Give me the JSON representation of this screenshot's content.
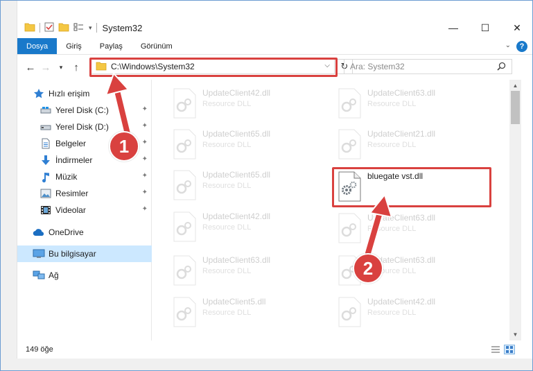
{
  "window": {
    "title": "System32",
    "controls": {
      "minimize": "—",
      "maximize": "☐",
      "close": "✕"
    }
  },
  "ribbon": {
    "tabs": [
      "Dosya",
      "Giriş",
      "Paylaş",
      "Görünüm"
    ],
    "active_tab": "Dosya",
    "help": "?"
  },
  "address_bar": {
    "path": "C:\\Windows\\System32",
    "search_placeholder": "Ara: System32"
  },
  "sidebar": {
    "quick_access": "Hızlı erişim",
    "pinned": [
      {
        "label": "Yerel Disk (C:)",
        "icon": "drive-icon"
      },
      {
        "label": "Yerel Disk (D:)",
        "icon": "drive-icon"
      },
      {
        "label": "Belgeler",
        "icon": "documents-icon"
      },
      {
        "label": "İndirmeler",
        "icon": "download-icon"
      },
      {
        "label": "Müzik",
        "icon": "music-icon"
      },
      {
        "label": "Resimler",
        "icon": "pictures-icon"
      },
      {
        "label": "Videolar",
        "icon": "videos-icon"
      }
    ],
    "onedrive": "OneDrive",
    "this_pc": "Bu bilgisayar",
    "network": "Ağ"
  },
  "files": {
    "left_column": [
      {
        "name": "UpdateClient42.dll",
        "type": "Resource DLL"
      },
      {
        "name": "UpdateClient65.dll",
        "type": "Resource DLL"
      },
      {
        "name": "UpdateClient65.dll",
        "type": "Resource DLL"
      },
      {
        "name": "UpdateClient42.dll",
        "type": "Resource DLL"
      },
      {
        "name": "UpdateClient63.dll",
        "type": "Resource DLL"
      },
      {
        "name": "UpdateClient5.dll",
        "type": "Resource DLL"
      }
    ],
    "right_column": [
      {
        "name": "UpdateClient63.dll",
        "type": "Resource DLL"
      },
      {
        "name": "UpdateClient21.dll",
        "type": "Resource DLL"
      },
      {
        "name": "UpdateClient63.dll",
        "type": "Resource DLL"
      },
      {
        "name": "UpdateClient63.dll",
        "type": "Resource DLL"
      },
      {
        "name": "UpdateClient42.dll",
        "type": "Resource DLL"
      }
    ],
    "highlighted": {
      "name": "bluegate vst.dll"
    }
  },
  "status": {
    "item_count": "149 öğe"
  },
  "callouts": {
    "step1": "1",
    "step2": "2"
  },
  "colors": {
    "accent": "#1979ca",
    "highlight_red": "#d9413f",
    "selection": "#cce8ff"
  }
}
